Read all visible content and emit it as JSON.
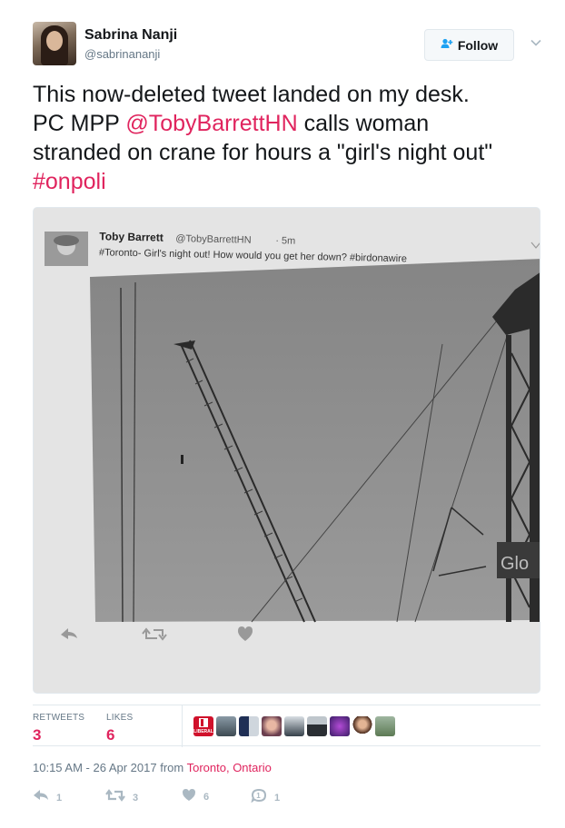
{
  "author": {
    "name": "Sabrina Nanji",
    "handle": "@sabrinananji"
  },
  "follow_label": "Follow",
  "tweet": {
    "line1": "This now-deleted tweet landed on my desk.",
    "line2_prefix": "PC MPP ",
    "mention": "@TobyBarrettHN",
    "line2_suffix": " calls woman",
    "line3": "stranded on crane for hours a \"girl's night out\"",
    "hashtag": "#onpoli"
  },
  "photo": {
    "embedded_name": "Toby Barrett",
    "embedded_handle": "@TobyBarrettHN",
    "embedded_time": "· 5m",
    "embedded_text": "#Toronto- Girl's night out! How would you get her down? #birdonawire",
    "sign_text": "Glo",
    "colors": {
      "paper": "#e6e6e6",
      "sky": "#8c8c8c",
      "steel": "#2e2e2e"
    }
  },
  "stats": {
    "retweets_label": "RETWEETS",
    "retweets_value": "3",
    "likes_label": "LIKES",
    "likes_value": "6",
    "liberal_badge_text": "LIBERAL"
  },
  "timestamp": {
    "time": "10:15 AM - 26 Apr 2017",
    "from": " from ",
    "location": "Toronto, Ontario"
  },
  "actions": {
    "reply_count": "1",
    "retweet_count": "3",
    "like_count": "6",
    "dm_count": "1"
  },
  "colors": {
    "link": "#e0245e",
    "follow_icon": "#1da1f2",
    "muted": "#657786",
    "action_gray": "#aab8c2"
  }
}
